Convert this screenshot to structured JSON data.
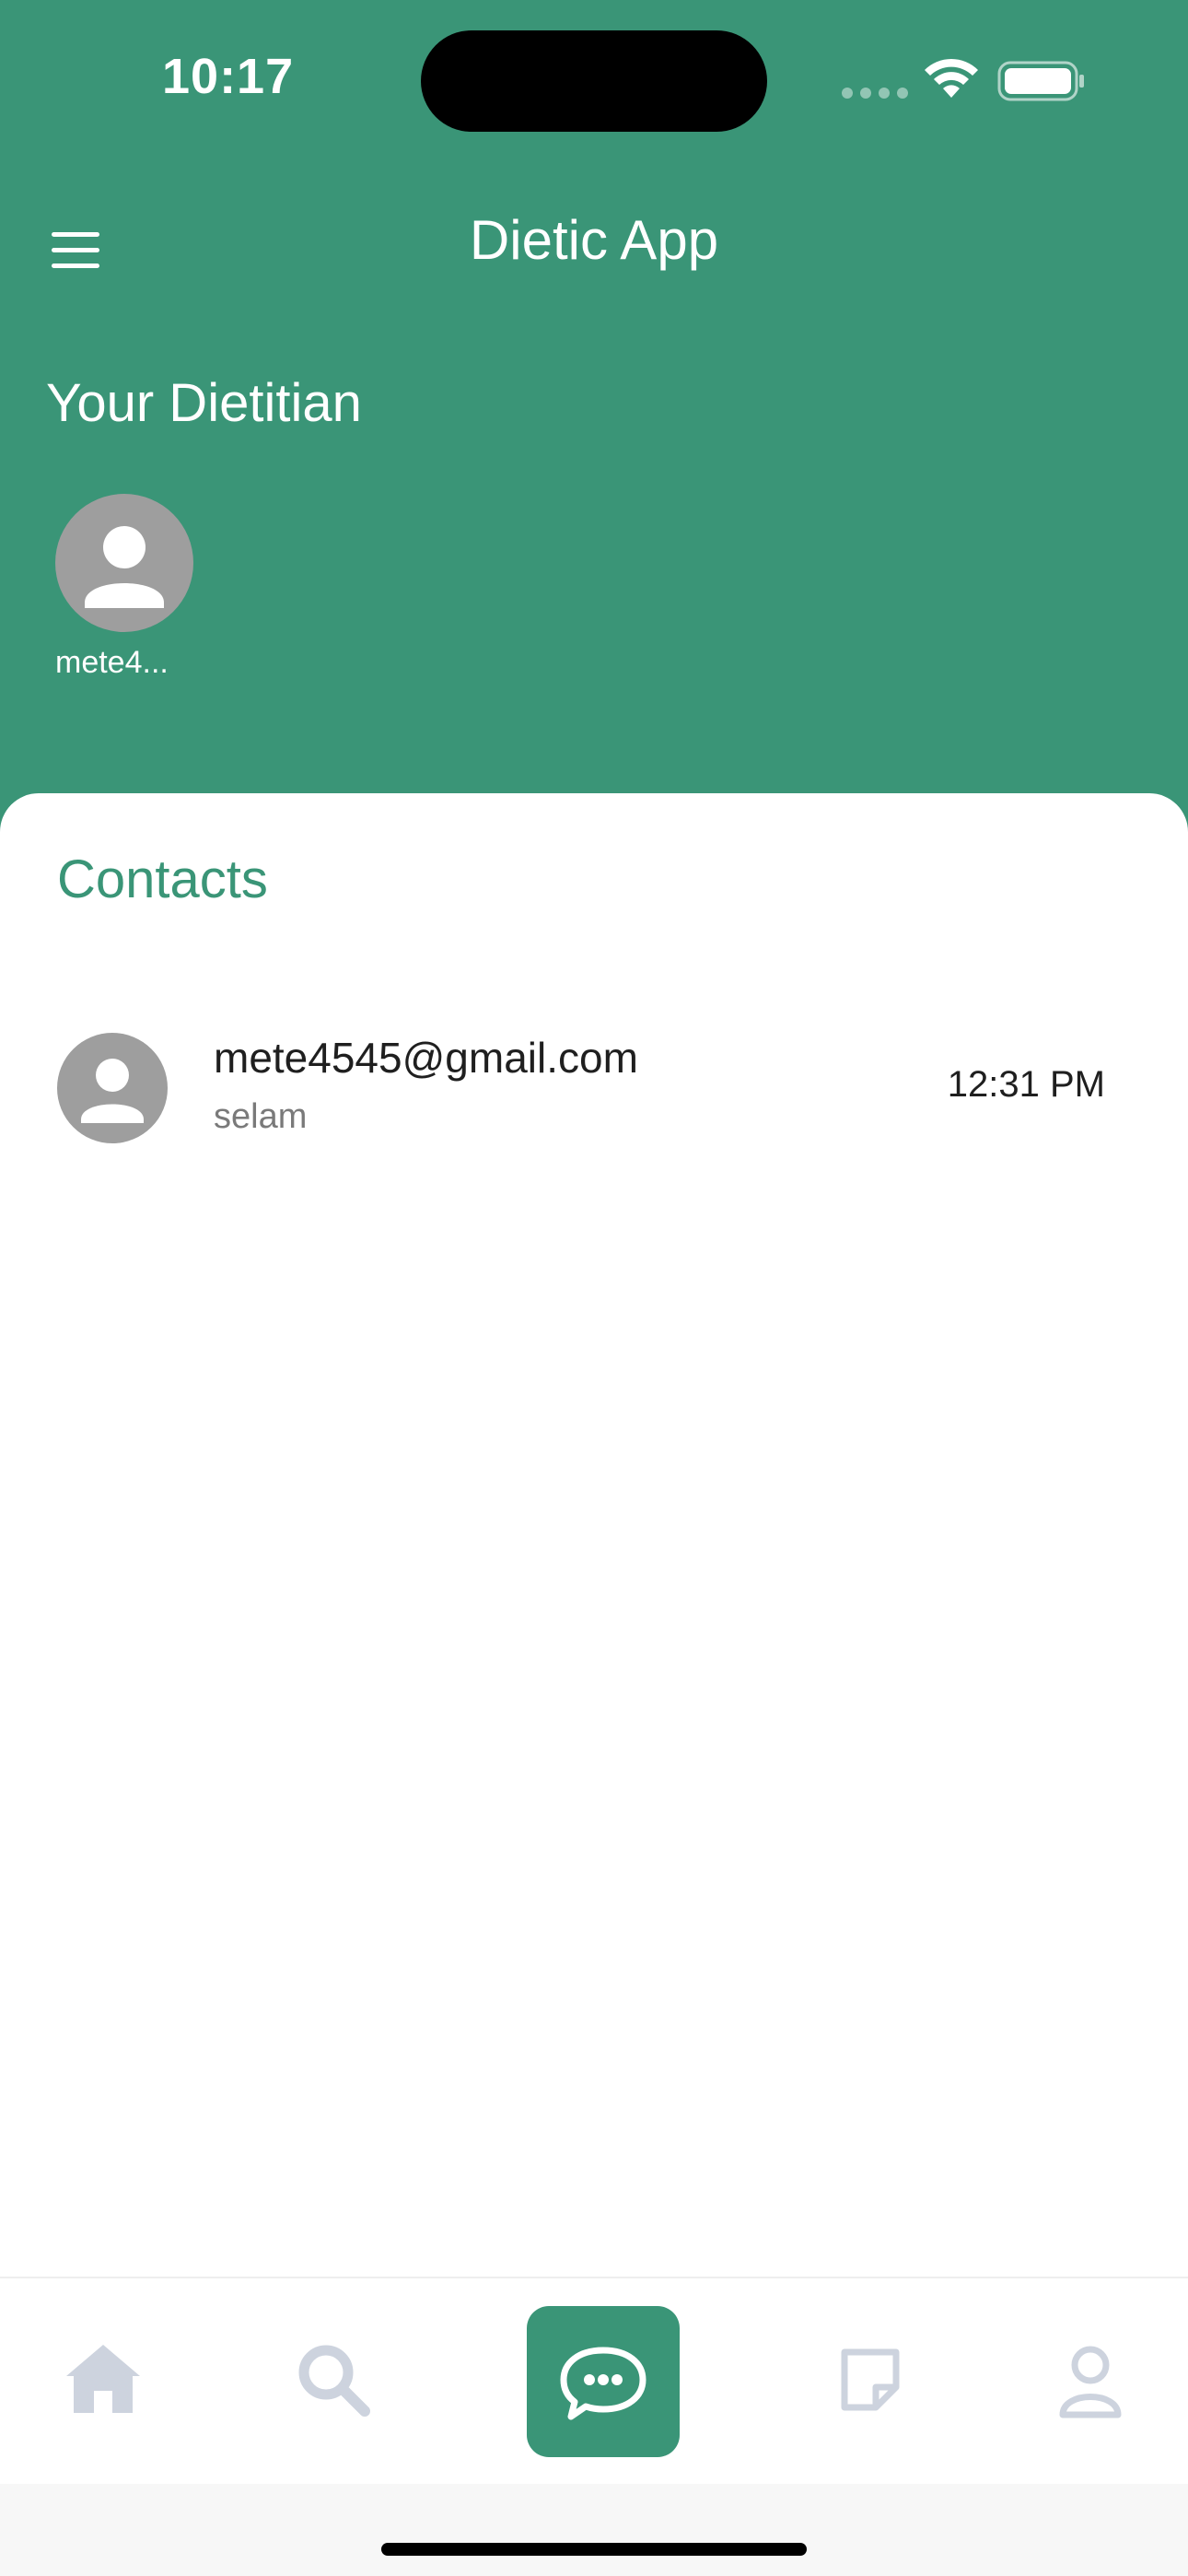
{
  "status_bar": {
    "time": "10:17"
  },
  "header": {
    "title": "Dietic App",
    "menu_icon": "hamburger-menu-icon"
  },
  "dietitian": {
    "heading": "Your Dietitian",
    "name": "mete4...",
    "avatar_icon": "person-icon"
  },
  "contacts": {
    "heading": "Contacts",
    "items": [
      {
        "email": "mete4545@gmail.com",
        "last_message": "selam",
        "time": "12:31 PM",
        "avatar_icon": "person-icon"
      }
    ]
  },
  "bottom_nav": {
    "items": [
      {
        "icon": "home-icon",
        "active": false
      },
      {
        "icon": "search-icon",
        "active": false
      },
      {
        "icon": "chat-icon",
        "active": true
      },
      {
        "icon": "note-icon",
        "active": false
      },
      {
        "icon": "profile-icon",
        "active": false
      }
    ]
  },
  "colors": {
    "brand": "#3a9577",
    "nav_inactive": "#cdd3de",
    "avatar_bg": "#9e9e9e"
  }
}
